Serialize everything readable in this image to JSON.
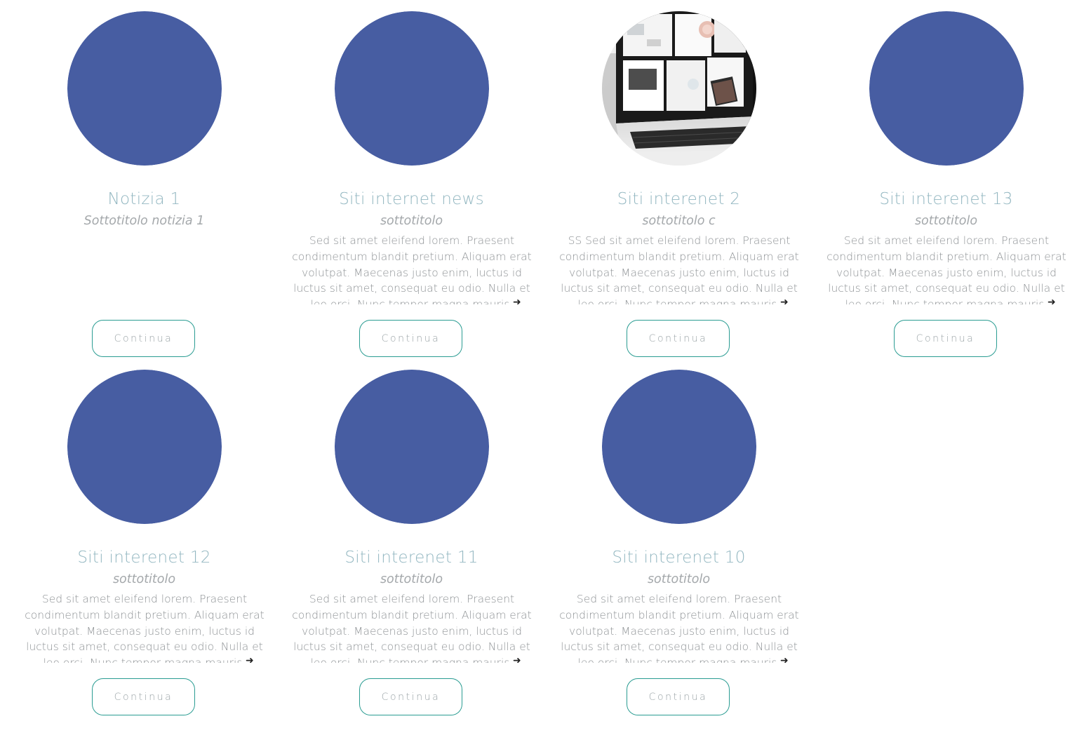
{
  "colors": {
    "placeholder_circle": "#475da2",
    "title_text": "#93b7c1",
    "subtitle_text": "#a4a8ab",
    "body_text": "#8f9396",
    "button_border": "#2a9c92"
  },
  "cards": [
    {
      "title": "Notizia 1",
      "subtitle": "Sottotitolo notizia 1",
      "excerpt": "",
      "image": "placeholder-circle",
      "button_label": "Continua"
    },
    {
      "title": "Siti internet news",
      "subtitle": "sottotitolo",
      "excerpt": "Sed sit amet eleifend lorem. Praesent condimentum blandit pretium. Aliquam erat volutpat. Maecenas justo enim, luctus id luctus sit amet, consequat eu odio. Nulla et leo orci. Nunc tempor magna mauris,",
      "image": "placeholder-circle",
      "button_label": "Continua"
    },
    {
      "title": "Siti interenet 2",
      "subtitle": "sottotitolo c",
      "excerpt": "SS Sed sit amet eleifend lorem. Praesent condimentum blandit pretium. Aliquam erat volutpat. Maecenas justo enim, luctus id luctus sit amet, consequat eu odio. Nulla et leo orci. Nunc tempor magna mauris,",
      "image": "laptop-photo",
      "button_label": "Continua"
    },
    {
      "title": "Siti interenet 13",
      "subtitle": "sottotitolo",
      "excerpt": "Sed sit amet eleifend lorem. Praesent condimentum blandit pretium. Aliquam erat volutpat. Maecenas justo enim, luctus id luctus sit amet, consequat eu odio. Nulla et leo orci. Nunc tempor magna mauris,",
      "image": "placeholder-circle",
      "button_label": "Continua"
    },
    {
      "title": "Siti interenet 12",
      "subtitle": "sottotitolo",
      "excerpt": "Sed sit amet eleifend lorem. Praesent condimentum blandit pretium. Aliquam erat volutpat. Maecenas justo enim, luctus id luctus sit amet, consequat eu odio. Nulla et leo orci. Nunc tempor magna mauris,",
      "image": "placeholder-circle",
      "button_label": "Continua"
    },
    {
      "title": "Siti interenet 11",
      "subtitle": "sottotitolo",
      "excerpt": "Sed sit amet eleifend lorem. Praesent condimentum blandit pretium. Aliquam erat volutpat. Maecenas justo enim, luctus id luctus sit amet, consequat eu odio. Nulla et leo orci. Nunc tempor magna mauris,",
      "image": "placeholder-circle",
      "button_label": "Continua"
    },
    {
      "title": "Siti interenet 10",
      "subtitle": "sottotitolo",
      "excerpt": "Sed sit amet eleifend lorem. Praesent condimentum blandit pretium. Aliquam erat volutpat. Maecenas justo enim, luctus id luctus sit amet, consequat eu odio. Nulla et leo orci. Nunc tempor magna mauris,",
      "image": "placeholder-circle",
      "button_label": "Continua"
    }
  ]
}
